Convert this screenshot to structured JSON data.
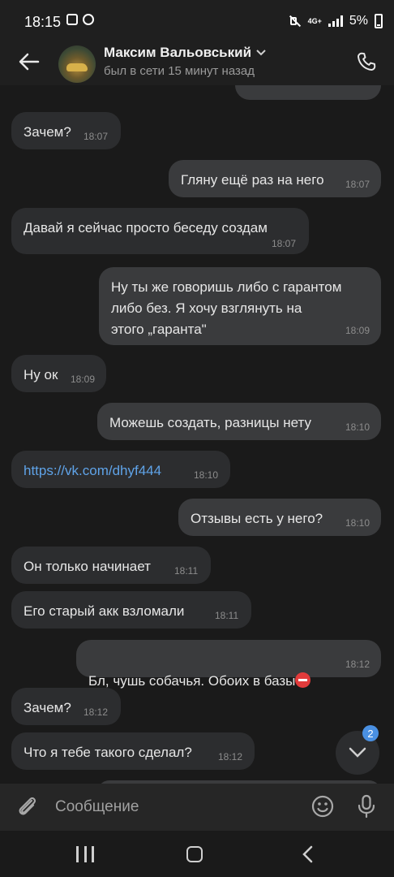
{
  "status_bar": {
    "time": "18:15",
    "network": "4G+",
    "battery": "5%"
  },
  "header": {
    "contact_name": "Максим Вальовський",
    "contact_status": "был в сети 15 минут назад"
  },
  "messages": [
    {
      "dir": "in",
      "text": "Зачем?",
      "time": "18:07"
    },
    {
      "dir": "out",
      "text": "Гляну ещё раз на него",
      "time": "18:07"
    },
    {
      "dir": "in",
      "text": "Давай я сейчас просто беседу создам",
      "time": "18:07"
    },
    {
      "dir": "out",
      "text": "Ну ты же говоришь либо с гарантом\nлибо без.  Я хочу взглянуть на\nэтого „гаранта\"",
      "time": "18:09"
    },
    {
      "dir": "in",
      "text": "Ну ок",
      "time": "18:09"
    },
    {
      "dir": "out",
      "text": "Можешь создать, разницы нету",
      "time": "18:10"
    },
    {
      "dir": "in",
      "text": "https://vk.com/dhyf444",
      "time": "18:10",
      "link": true
    },
    {
      "dir": "out",
      "text": "Отзывы есть у него?",
      "time": "18:10"
    },
    {
      "dir": "in",
      "text": "Он только начинает",
      "time": "18:11"
    },
    {
      "dir": "in",
      "text": "Его старый акк взломали",
      "time": "18:11"
    },
    {
      "dir": "out",
      "text": "Бл, чушь собачья. Обоих в базы",
      "time": "18:12",
      "emoji": "no-entry-emoji"
    },
    {
      "dir": "in",
      "text": "Зачем?",
      "time": "18:12"
    },
    {
      "dir": "in",
      "text": "Что я тебе такого сделал?",
      "time": "18:12"
    }
  ],
  "scroll_down": {
    "badge": "2",
    "icon": "chevron-down-icon"
  },
  "composer": {
    "placeholder": "Сообщение"
  },
  "colors": {
    "background": "#1a1a1a",
    "incoming_bubble": "#2c2d2f",
    "outgoing_bubble": "#3a3b3d",
    "link": "#5fa3e8",
    "accent": "#4a90e2"
  }
}
